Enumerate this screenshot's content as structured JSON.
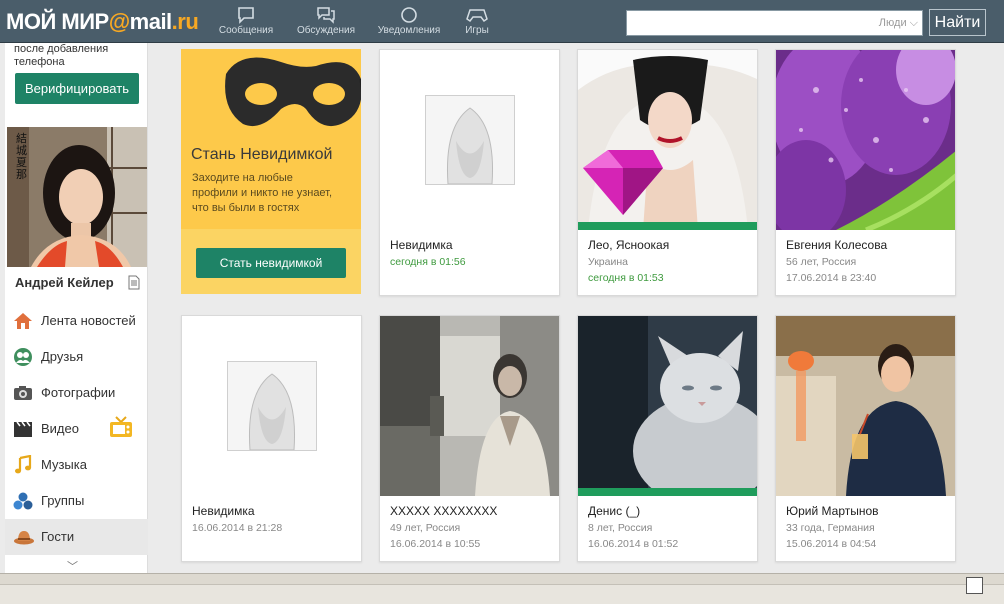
{
  "header": {
    "logo_text": "МОЙ МИР",
    "logo_at": "@",
    "logo_mail": "mail",
    "logo_ru": ".ru",
    "nav": [
      {
        "label": "Сообщения",
        "icon": "message-icon"
      },
      {
        "label": "Обсуждения",
        "icon": "discussions-icon"
      },
      {
        "label": "Уведомления",
        "icon": "notifications-icon"
      },
      {
        "label": "Игры",
        "icon": "gamepad-icon"
      }
    ],
    "search": {
      "value": "",
      "placeholder": "",
      "scope": "Люди"
    },
    "search_button": "Найти"
  },
  "sidebar": {
    "verify_text_line1": "после добавления",
    "verify_text_line2": "телефона",
    "verify_button": "Верифицировать",
    "user_name": "Андрей Кейлер",
    "avatar_overlay_text": "結城夏那",
    "menu": [
      {
        "label": "Лента новостей",
        "icon": "home-icon"
      },
      {
        "label": "Друзья",
        "icon": "friends-icon"
      },
      {
        "label": "Фотографии",
        "icon": "camera-icon"
      },
      {
        "label": "Видео",
        "icon": "video-icon"
      },
      {
        "label": "Музыка",
        "icon": "music-icon"
      },
      {
        "label": "Группы",
        "icon": "groups-icon"
      },
      {
        "label": "Гости",
        "icon": "guests-icon"
      }
    ]
  },
  "promo": {
    "title": "Стань Невидимкой",
    "text_line1": "Заходите на любые",
    "text_line2": "профили и никто не узнает,",
    "text_line3": "что вы были в гостях",
    "button": "Стать невидимкой"
  },
  "guests": [
    {
      "name": "Невидимка",
      "line1": "сегодня в 01:56",
      "line2": "",
      "photo": "silhouette"
    },
    {
      "name": "Лео, Ясноокая",
      "line1": "Украина",
      "line2": "сегодня в 01:53",
      "photo": "woman-hat-diamond",
      "online": true
    },
    {
      "name": "Евгения Колесова",
      "line1": "56 лет, Россия",
      "line2": "17.06.2014 в 23:40",
      "photo": "purple-tulips"
    },
    {
      "name": "Невидимка",
      "line1": "16.06.2014 в 21:28",
      "line2": "",
      "photo": "silhouette"
    },
    {
      "name": "XXXXX XXXXXXXX",
      "line1": "49 лет, Россия",
      "line2": "16.06.2014 в 10:55",
      "photo": "woman-market"
    },
    {
      "name": "Денис (_)",
      "line1": "8 лет, Россия",
      "line2": "16.06.2014 в 01:52",
      "photo": "white-cat",
      "online": true
    },
    {
      "name": "Юрий Мартынов",
      "line1": "33 года, Германия",
      "line2": "15.06.2014 в 04:54",
      "photo": "man-cafe"
    }
  ],
  "colors": {
    "header_bg": "#4a5d6a",
    "accent_green": "#1e8366",
    "online_green": "#1f9c5c",
    "promo_yellow": "#fdc94a",
    "logo_orange": "#f7a823"
  }
}
